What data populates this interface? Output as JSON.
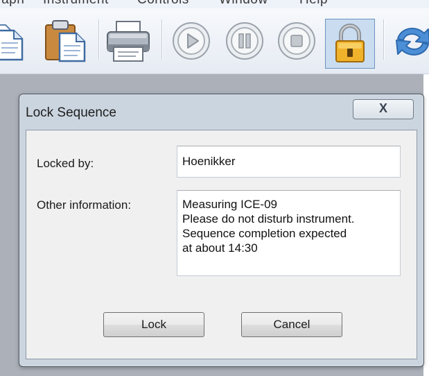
{
  "menubar": {
    "items": [
      {
        "label": "Graph"
      },
      {
        "label": "Instrument"
      },
      {
        "label": "Controls"
      },
      {
        "label": "Window"
      },
      {
        "label": "Help"
      }
    ]
  },
  "toolbar": {
    "buttons": [
      {
        "icon": "copy-icon"
      },
      {
        "icon": "paste-icon"
      },
      {
        "icon": "printer-icon"
      },
      {
        "icon": "play-icon"
      },
      {
        "icon": "pause-icon"
      },
      {
        "icon": "stop-icon"
      },
      {
        "icon": "padlock-icon",
        "state": "active"
      },
      {
        "icon": "refresh-icon"
      }
    ]
  },
  "dialog": {
    "title": "Lock Sequence",
    "close_label": "X",
    "locked_by": {
      "label": "Locked by:",
      "value": "Hoenikker"
    },
    "other_information": {
      "label": "Other information:",
      "value": "Measuring ICE-09\nPlease do not disturb instrument.\nSequence completion expected\nat about 14:30"
    },
    "buttons": {
      "lock": "Lock",
      "cancel": "Cancel"
    }
  },
  "colors": {
    "toolbar_bg": "#eaeef5",
    "workspace_bg": "#abb0b9",
    "dialog_frame": "#cbd5df",
    "dialog_client": "#f0f0f0",
    "lock_active_bg": "#c9dcf0",
    "padlock_gold": "#e9a21b"
  }
}
